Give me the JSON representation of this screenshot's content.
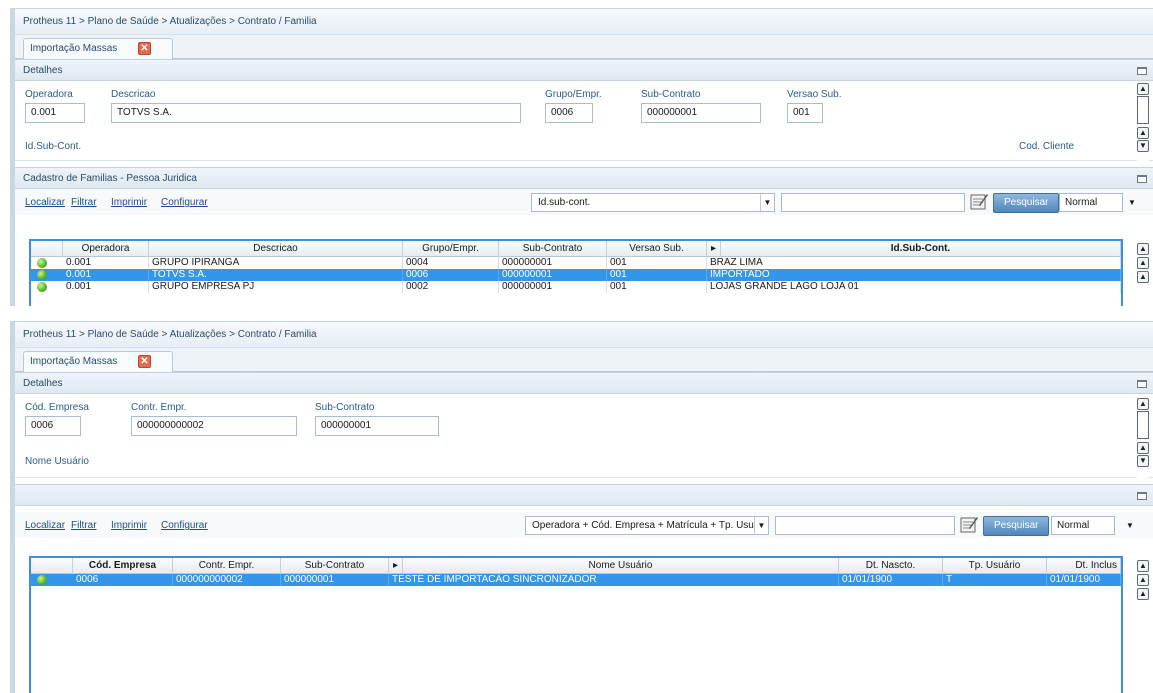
{
  "breadcrumb": "Protheus 11 > Plano de Saúde > Atualizações > Contrato / Familia",
  "tab": {
    "label": "Importação Massas",
    "close": "✕"
  },
  "top": {
    "details_title": "Detalhes",
    "fields": {
      "operadora_label": "Operadora",
      "operadora_value": "0.001",
      "descricao_label": "Descricao",
      "descricao_value": "TOTVS S.A.",
      "grupo_label": "Grupo/Empr.",
      "grupo_value": "0006",
      "subcontrato_label": "Sub-Contrato",
      "subcontrato_value": "000000001",
      "versao_label": "Versao Sub.",
      "versao_value": "001",
      "idsub_label": "Id.Sub-Cont.",
      "codcliente_label": "Cod. Cliente"
    },
    "list_title": "Cadastro de Familias - Pessoa Juridica",
    "toolbar": {
      "localizar": "Localizar",
      "filtrar": "Filtrar",
      "imprimir": "Imprimir",
      "configurar": "Configurar",
      "index_value": "Id.sub-cont.",
      "search_button": "Pesquisar",
      "mode": "Normal"
    },
    "columns": [
      "Operadora",
      "Descricao",
      "Grupo/Empr.",
      "Sub-Contrato",
      "Versao Sub.",
      "▸",
      "Id.Sub-Cont."
    ],
    "rows": [
      {
        "status": "green",
        "cells": [
          "0.001",
          "GRUPO IPIRANGA",
          "0004",
          "000000001",
          "001",
          "BRAZ LIMA"
        ]
      },
      {
        "status": "green",
        "cells": [
          "0.001",
          "TOTVS S.A.",
          "0006",
          "000000001",
          "001",
          "IMPORTADO"
        ],
        "selected": true
      },
      {
        "status": "green",
        "cells": [
          "0.001",
          "GRUPO EMPRESA PJ",
          "0002",
          "000000001",
          "001",
          "LOJAS GRANDE LAGO LOJA 01"
        ]
      }
    ]
  },
  "bottom": {
    "details_title": "Detalhes",
    "fields": {
      "codempresa_label": "Cód. Empresa",
      "codempresa_value": "0006",
      "contr_label": "Contr. Empr.",
      "contr_value": "000000000002",
      "subcontrato_label": "Sub-Contrato",
      "subcontrato_value": "000000001",
      "nomeusuario_label": "Nome Usuário"
    },
    "list_title": "",
    "toolbar": {
      "localizar": "Localizar",
      "filtrar": "Filtrar",
      "imprimir": "Imprimir",
      "configurar": "Configurar",
      "index_value": "Operadora + Cód. Empresa + Matrícula + Tp. Usu",
      "search_button": "Pesquisar",
      "mode": "Normal"
    },
    "columns": [
      "Cód. Empresa",
      "Contr. Empr.",
      "Sub-Contrato",
      "▸",
      "Nome Usuário",
      "Dt. Nascto.",
      "Tp. Usuário",
      "Dt. Inclus"
    ],
    "rows": [
      {
        "status": "green",
        "cells": [
          "0006",
          "000000000002",
          "000000001",
          "TESTE DE IMPORTACAO SINCRONIZADOR",
          "01/01/1900",
          "T",
          "01/01/1900"
        ],
        "selected": true
      }
    ]
  },
  "icons": {
    "scroll_up": "▲",
    "scroll_down": "▼",
    "dropdown": "▼",
    "notepad": "notepad-icon",
    "status_dot": "green-status-icon"
  },
  "colors": {
    "selection": "#3396ea",
    "grid_border": "#3a8fe0",
    "link": "#1f4f86",
    "status_green": "#53b51f"
  }
}
